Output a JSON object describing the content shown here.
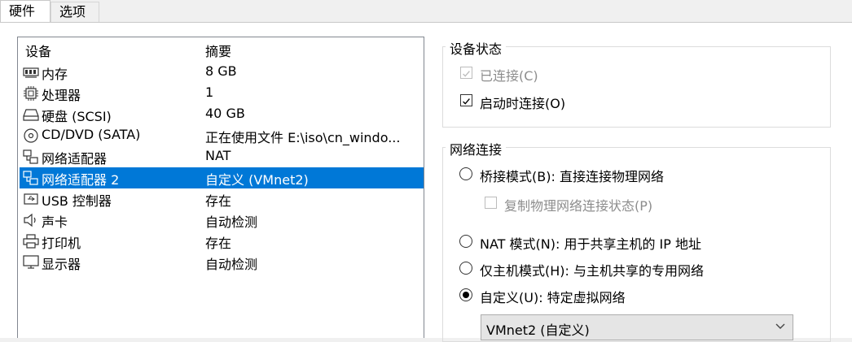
{
  "tabs": {
    "hardware": "硬件",
    "options": "选项"
  },
  "list": {
    "col_device": "设备",
    "col_summary": "摘要",
    "rows": [
      {
        "name": "内存",
        "summary": "8 GB",
        "icon": "memory-icon"
      },
      {
        "name": "处理器",
        "summary": "1",
        "icon": "processor-icon"
      },
      {
        "name": "硬盘 (SCSI)",
        "summary": "40 GB",
        "icon": "hard-disk-icon"
      },
      {
        "name": "CD/DVD (SATA)",
        "summary": "正在使用文件 E:\\iso\\cn_windo...",
        "icon": "cd-dvd-icon"
      },
      {
        "name": "网络适配器",
        "summary": "NAT",
        "icon": "network-adapter-icon"
      },
      {
        "name": "网络适配器 2",
        "summary": "自定义 (VMnet2)",
        "icon": "network-adapter-icon",
        "selected": true
      },
      {
        "name": "USB 控制器",
        "summary": "存在",
        "icon": "usb-icon"
      },
      {
        "name": "声卡",
        "summary": "自动检测",
        "icon": "speaker-icon"
      },
      {
        "name": "打印机",
        "summary": "存在",
        "icon": "printer-icon"
      },
      {
        "name": "显示器",
        "summary": "自动检测",
        "icon": "monitor-icon"
      }
    ]
  },
  "device_status": {
    "title": "设备状态",
    "connected": "已连接(C)",
    "connect_at_power_on": "启动时连接(O)"
  },
  "network": {
    "title": "网络连接",
    "bridged": "桥接模式(B): 直接连接物理网络",
    "replicate": "复制物理网络连接状态(P)",
    "nat": "NAT 模式(N): 用于共享主机的 IP 地址",
    "host_only": "仅主机模式(H): 与主机共享的专用网络",
    "custom": "自定义(U): 特定虚拟网络",
    "custom_value": "VMnet2 (自定义)"
  },
  "colors": {
    "selection": "#0078d7",
    "border": "#828790"
  }
}
